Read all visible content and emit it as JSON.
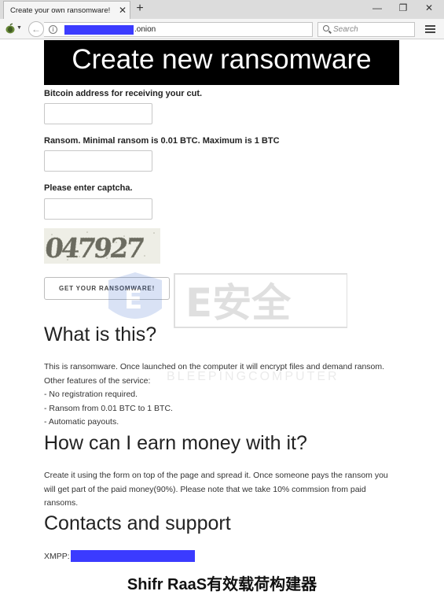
{
  "browser": {
    "tab_title": "Create your own ransomware!",
    "tab_close": "✕",
    "new_tab": "+",
    "window_controls": {
      "minimize": "—",
      "restore": "❐",
      "close": "✕"
    },
    "url_suffix": ".onion",
    "search_placeholder": "Search",
    "reload": "↻",
    "back": "🡐",
    "info": "i"
  },
  "page": {
    "heading": "Create new ransomware",
    "form": {
      "bitcoin_label": "Bitcoin address for receiving your cut.",
      "bitcoin_value": "",
      "ransom_label": "Ransom. Minimal ransom is 0.01 BTC. Maximum is 1 BTC",
      "ransom_value": "",
      "captcha_label": "Please enter captcha.",
      "captcha_value": "",
      "captcha_image_text": "047927",
      "submit_label": "GET YOUR RANSOMWARE!"
    },
    "sections": {
      "what_title": "What is this?",
      "what_lines": [
        "This is ransomware. Once launched on the computer it will encrypt files and demand ransom.",
        "Other features of the service:",
        "- No registration required.",
        "- Ransom from 0.01 BTC to 1 BTC.",
        "- Automatic payouts."
      ],
      "earn_title": "How can I earn money with it?",
      "earn_lines": [
        "Create it using the form on top of the page and spread it. Once someone pays the ransom you",
        "will get part of the paid money(90%). Please note that we take 10% commsion from paid",
        "ransoms."
      ],
      "contacts_title": "Contacts and support",
      "xmpp_label": "XMPP:"
    }
  },
  "watermarks": {
    "logo_text": "E安全",
    "source_text": "BLEEPINGCOMPUTER"
  },
  "caption": "Shifr RaaS有效载荷构建器",
  "colors": {
    "redaction": "#3b3bff",
    "banner_bg": "#000000",
    "banner_text": "#ffffff"
  }
}
